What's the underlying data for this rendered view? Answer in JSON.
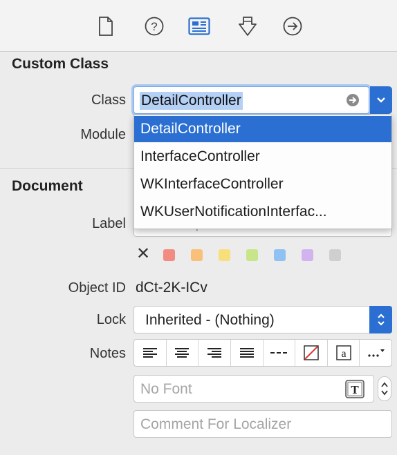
{
  "tabs": [
    {
      "name": "file-inspector",
      "icon": "file-icon"
    },
    {
      "name": "quick-help",
      "icon": "question-icon"
    },
    {
      "name": "identity-inspector",
      "icon": "identity-card-icon"
    },
    {
      "name": "attributes-inspector",
      "icon": "attributes-icon"
    },
    {
      "name": "connections-inspector",
      "icon": "arrow-right-circle-icon"
    }
  ],
  "custom_class": {
    "section_title": "Custom Class",
    "class_label": "Class",
    "class_value": "DetailController",
    "module_label": "Module"
  },
  "dropdown": {
    "items": [
      "DetailController",
      "InterfaceController",
      "WKInterfaceController",
      "WKUserNotificationInterfac..."
    ],
    "selected_index": 0
  },
  "document": {
    "section_title": "Document",
    "label_label": "Label",
    "label_placeholder": "Xcode Specific Label",
    "swatch_colors": [
      "#f28b82",
      "#f9c07a",
      "#f7e07c",
      "#c9e58a",
      "#8fc1f2",
      "#d3b3ef",
      "#cfcfcf"
    ],
    "object_id_label": "Object ID",
    "object_id_value": "dCt-2K-ICv",
    "lock_label": "Lock",
    "lock_value": "Inherited - (Nothing)",
    "notes_label": "Notes",
    "font_placeholder": "No Font",
    "comment_placeholder": "Comment For Localizer"
  },
  "colors": {
    "accent": "#2a6fd1",
    "selection": "#b4d0f5"
  }
}
